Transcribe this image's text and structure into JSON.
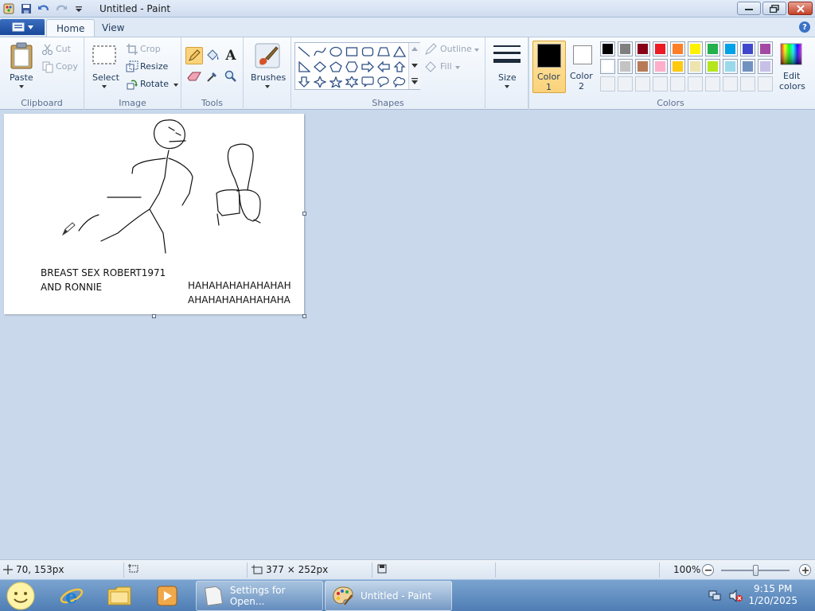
{
  "window": {
    "title": "Untitled - Paint"
  },
  "tabs": [
    {
      "label": "Home"
    },
    {
      "label": "View"
    }
  ],
  "ribbon": {
    "clipboard": {
      "label": "Clipboard",
      "paste": "Paste",
      "cut": "Cut",
      "copy": "Copy"
    },
    "image": {
      "label": "Image",
      "select": "Select",
      "crop": "Crop",
      "resize": "Resize",
      "rotate": "Rotate"
    },
    "tools": {
      "label": "Tools"
    },
    "brushes": {
      "label": "Brushes"
    },
    "shapes": {
      "label": "Shapes",
      "outline": "Outline",
      "fill": "Fill"
    },
    "size": {
      "label": "Size"
    },
    "color1": {
      "label_top": "Color",
      "label_bottom": "1",
      "value": "#000000"
    },
    "color2": {
      "label_top": "Color",
      "label_bottom": "2",
      "value": "#ffffff"
    },
    "colors": {
      "label": "Colors",
      "edit_top": "Edit",
      "edit_bottom": "colors",
      "row1": [
        "#000000",
        "#7f7f7f",
        "#880015",
        "#ed1c24",
        "#ff7f27",
        "#fff200",
        "#22b14c",
        "#00a2e8",
        "#3f48cc",
        "#a349a4"
      ],
      "row2": [
        "#ffffff",
        "#c3c3c3",
        "#b97a57",
        "#ffaec9",
        "#ffc90e",
        "#efe4b0",
        "#b5e61d",
        "#99d9ea",
        "#7092be",
        "#c8bfe7"
      ]
    }
  },
  "canvas": {
    "text_left_line1": "BREAST SEX ROBERT1971",
    "text_left_line2": "AND RONNIE",
    "text_right_line1": "HAHAHAHAHAHAHAH",
    "text_right_line2": "AHAHAHAHAHAHAHA"
  },
  "status": {
    "cursor_position": "70, 153px",
    "image_size": "377 × 252px",
    "zoom": "100%"
  },
  "taskbar": {
    "window1": "Settings for Open...",
    "window2": "Untitled - Paint",
    "time": "9:15 PM",
    "date": "1/20/2025"
  }
}
